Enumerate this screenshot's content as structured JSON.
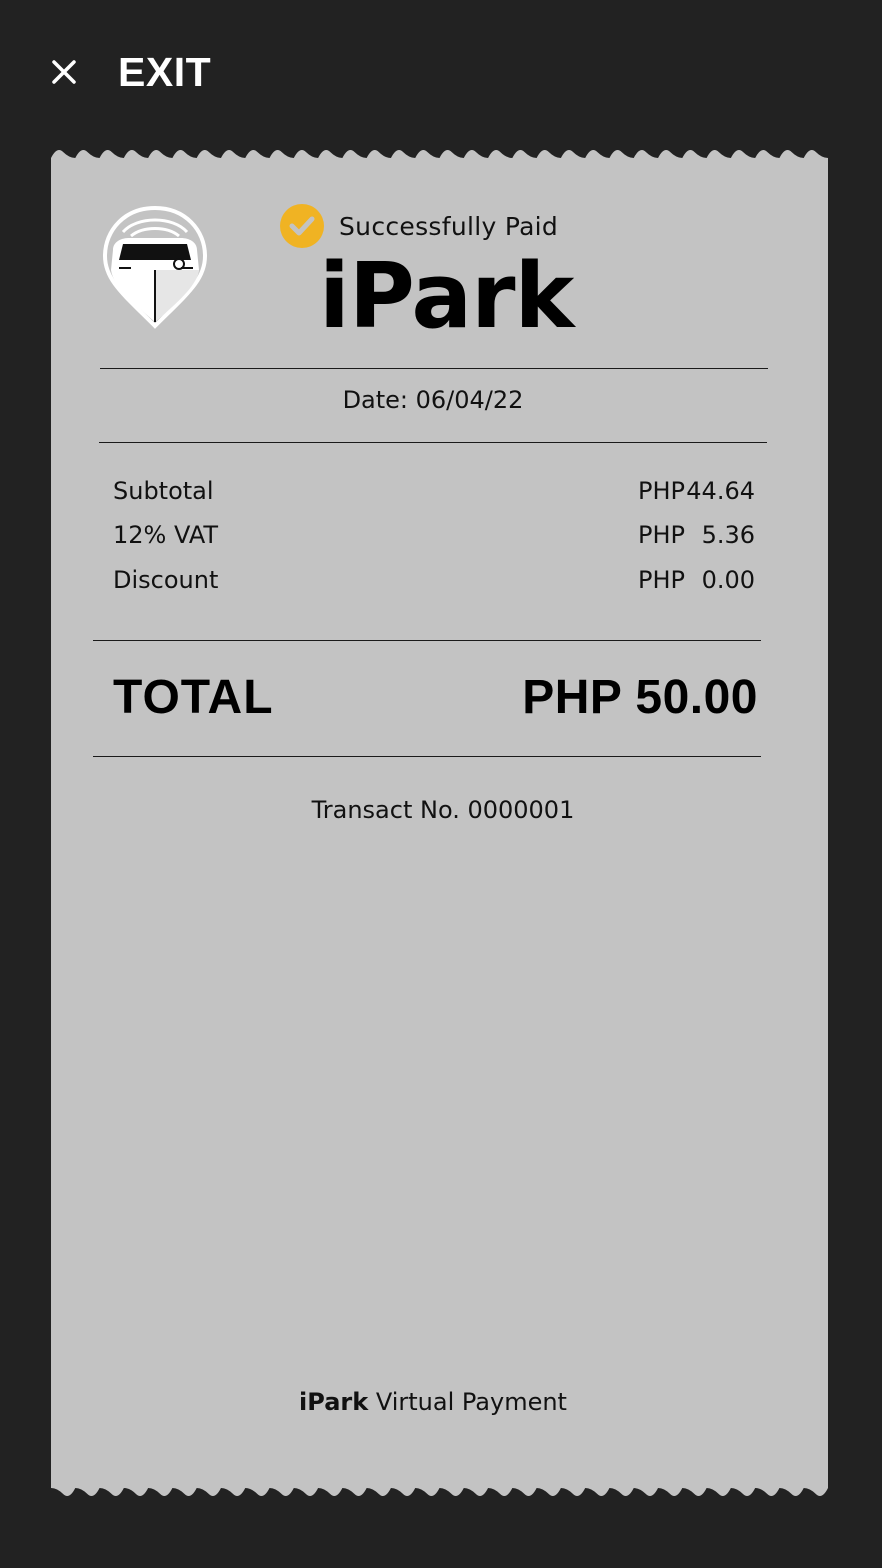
{
  "exit": {
    "label": "EXIT",
    "icon": "close-icon"
  },
  "receipt": {
    "logo_icon": "ipark-car-pin-logo",
    "status": {
      "icon": "check-circle-icon",
      "icon_color": "#F0B323",
      "text": "Successfully Paid"
    },
    "brand": "iPark",
    "date_label": "Date: 06/04/22",
    "lines": [
      {
        "name": "Subtotal",
        "currency": "PHP",
        "amount": "44.64"
      },
      {
        "name": "12% VAT",
        "currency": "PHP",
        "amount": "5.36"
      },
      {
        "name": "Discount",
        "currency": "PHP",
        "amount": "0.00"
      }
    ],
    "total_label": "TOTAL",
    "total_value": "PHP 50.00",
    "transaction": "Transact No. 0000001",
    "footer_brand": "iPark",
    "footer_text": "Virtual Payment"
  },
  "colors": {
    "background": "#222222",
    "paper": "#C3C3C3",
    "accent": "#F0B323",
    "text": "#111111"
  }
}
